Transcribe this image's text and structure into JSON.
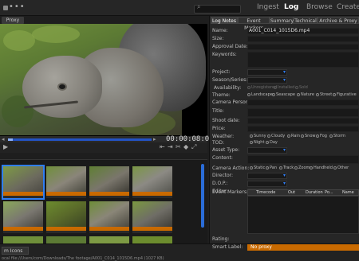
{
  "topbar": {
    "ingest": "Ingest",
    "log": "Log",
    "browse": "Browse",
    "create": "Create"
  },
  "viewer": {
    "proxy_tab": "Proxy",
    "timecode": "00:00:08:06"
  },
  "bottombar": {
    "view_select": "m Icons",
    "path": "ocal file://Users/com/Downloads/The footage/A001_C014_1015D6.mp4 (1027 KB)"
  },
  "panel": {
    "tabs": [
      "Log Notes",
      "Event Markers",
      "Summary",
      "Technical",
      "Archive & Proxy"
    ],
    "name_label": "Name:",
    "name_value": "A001_C014_1015D6.mp4",
    "size_label": "Size:",
    "approval_label": "Approval Date:",
    "keywords_label": "Keywords:",
    "project_label": "Project:",
    "season_label": "Season/Series:",
    "availability_label": "Availability:",
    "availability_options": [
      "Unregistered",
      "Installed",
      "Sold"
    ],
    "theme_label": "Theme:",
    "theme_options": [
      "Landscape",
      "Seascape",
      "Nature",
      "Street",
      "Figurative"
    ],
    "camera_label": "Camera Person:",
    "title_label": "Title:",
    "shoot_label": "Shoot date:",
    "price_label": "Price:",
    "weather_label": "Weather:",
    "weather_options": [
      "Sunny",
      "Cloudy",
      "Rain",
      "Snow",
      "Fog",
      "Storm"
    ],
    "tod_label": "TOD:",
    "tod_options": [
      "Night",
      "Day"
    ],
    "asset_label": "Asset Type:",
    "content_label": "Content:",
    "camera_action_label": "Camera Action:",
    "camera_action_options": [
      "Static",
      "Pan",
      "Track",
      "Zoom",
      "Handheld",
      "Other"
    ],
    "director_label": "Director:",
    "dop_label": "D.O.P.:",
    "editor_label": "Editor:",
    "event_markers_label": "Event Markers:",
    "em_columns": [
      "Timecode",
      "Out",
      "Duration",
      "Po...",
      "Name"
    ],
    "rating_label": "Rating:",
    "smart_label": "Smart Label:",
    "smart_value": "No proxy"
  }
}
